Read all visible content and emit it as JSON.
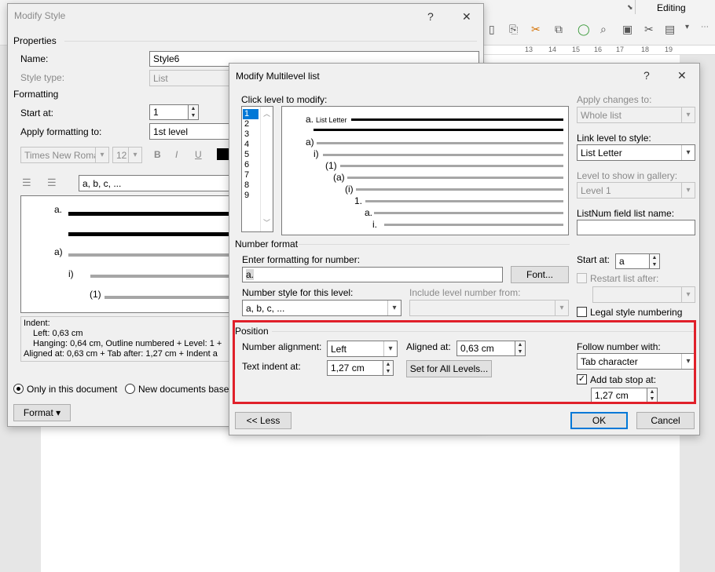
{
  "ribbon": {
    "editing_label": "Editing",
    "launcher_icon": "dialog-launcher-icon",
    "ruler_numbers": [
      "13",
      "14",
      "15",
      "16",
      "17",
      "18",
      "19"
    ]
  },
  "modify_style": {
    "title": "Modify Style",
    "help_btn": "?",
    "close_btn": "✕",
    "properties_label": "Properties",
    "name_label": "Name:",
    "name_value": "Style6",
    "style_type_label": "Style type:",
    "style_type_value": "List",
    "formatting_label": "Formatting",
    "start_at_label": "Start at:",
    "start_at_value": "1",
    "apply_to_label": "Apply formatting to:",
    "apply_to_value": "1st level",
    "font_value": "Times New Roman",
    "size_value": "12",
    "bold": "B",
    "italic": "I",
    "underline": "U",
    "numbering_value": "a, b, c, ...",
    "preview": [
      "a.",
      "a)",
      "i)",
      "(1)"
    ],
    "indent_text": {
      "line1": "Indent:",
      "line2": "Left:  0,63 cm",
      "line3": "Hanging:  0,64 cm, Outline numbered + Level: 1 +",
      "line4": "Aligned at:  0,63 cm + Tab after:  1,27 cm + Indent a"
    },
    "only_doc_label": "Only in this document",
    "new_docs_label": "New documents based",
    "format_btn": "Format ▾"
  },
  "multilevel": {
    "title": "Modify Multilevel list",
    "help_btn": "?",
    "close_btn": "✕",
    "click_level_label": "Click level to modify:",
    "levels": [
      "1",
      "2",
      "3",
      "4",
      "5",
      "6",
      "7",
      "8",
      "9"
    ],
    "selected_level": "1",
    "preview": {
      "first_label": "a.",
      "first_style": "List Letter",
      "labels": [
        "a)",
        "i)",
        "(1)",
        "(a)",
        "(i)",
        "1.",
        "a.",
        "i."
      ]
    },
    "apply_changes_label": "Apply changes to:",
    "apply_changes_value": "Whole list",
    "link_level_label": "Link level to style:",
    "link_level_value": "List Letter",
    "gallery_level_label": "Level to show in gallery:",
    "gallery_level_value": "Level 1",
    "listnum_label": "ListNum field list name:",
    "listnum_value": "",
    "number_format_title": "Number format",
    "enter_format_label": "Enter formatting for number:",
    "enter_format_value": "a.",
    "font_btn": "Font...",
    "number_style_label": "Number style for this level:",
    "number_style_value": "a, b, c, ...",
    "include_level_label": "Include level number from:",
    "include_level_value": "",
    "start_at_label": "Start at:",
    "start_at_value": "a",
    "restart_label": "Restart list after:",
    "legal_label": "Legal style numbering",
    "position_title": "Position",
    "number_alignment_label": "Number alignment:",
    "number_alignment_value": "Left",
    "aligned_at_label": "Aligned at:",
    "aligned_at_value": "0,63 cm",
    "text_indent_label": "Text indent at:",
    "text_indent_value": "1,27 cm",
    "set_all_btn": "Set for All Levels...",
    "follow_label": "Follow number with:",
    "follow_value": "Tab character",
    "add_tab_label": "Add tab stop at:",
    "add_tab_checked": "✓",
    "add_tab_value": "1,27 cm",
    "less_btn": "<< Less",
    "ok_btn": "OK",
    "cancel_btn": "Cancel"
  },
  "colors": {
    "highlight_border": "#e0202a",
    "accent": "#0078d7"
  }
}
